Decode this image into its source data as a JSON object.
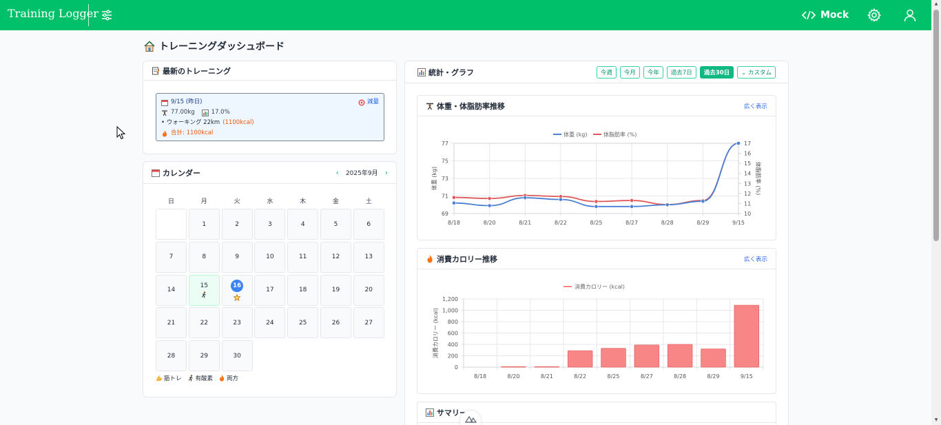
{
  "header": {
    "brand": "Training Logger",
    "mock_label": "Mock"
  },
  "page": {
    "title": "トレーニングダッシュボード"
  },
  "latest": {
    "title": "最新のトレーニング",
    "date": "9/15 (昨日)",
    "goal": "減量",
    "weight": "77.00kg",
    "body_fat": "17.0%",
    "activity": "• ウォーキング 22km",
    "activity_kcal": "(1100kcal)",
    "total": "合計: 1100kcal"
  },
  "calendar": {
    "title": "カレンダー",
    "month": "2025年9月",
    "weekdays": [
      "日",
      "月",
      "火",
      "水",
      "木",
      "金",
      "土"
    ],
    "legend": {
      "strength": "筋トレ",
      "cardio": "有酸素",
      "both": "両方"
    }
  },
  "stats": {
    "title": "統計・グラフ",
    "ranges": [
      "今週",
      "今月",
      "今年",
      "過去7日",
      "過去30日",
      "カスタム"
    ],
    "active_range": "過去30日",
    "expand": "広く表示",
    "summary_title": "サマリー"
  },
  "chart_data": [
    {
      "type": "line",
      "title": "体重・体脂肪率推移",
      "x": [
        "8/18",
        "8/20",
        "8/21",
        "8/22",
        "8/25",
        "8/27",
        "8/28",
        "8/29",
        "9/15"
      ],
      "series": [
        {
          "name": "体重 (kg)",
          "axis": "left",
          "color": "#4a7fd6",
          "values": [
            70.2,
            69.9,
            70.8,
            70.6,
            69.8,
            69.8,
            70.0,
            70.4,
            77.0
          ]
        },
        {
          "name": "体脂肪率 (%)",
          "axis": "right",
          "color": "#e05757",
          "values": [
            11.6,
            11.5,
            11.8,
            11.7,
            11.2,
            11.3,
            10.9,
            11.3,
            17.0
          ]
        }
      ],
      "ylabel": "体重 (kg)",
      "ylabel_right": "体脂肪率 (%)",
      "ylim": [
        69,
        77
      ],
      "yticks": [
        69,
        71,
        73,
        75,
        77
      ],
      "ylim_right": [
        10,
        17
      ],
      "yticks_right": [
        10,
        11,
        12,
        13,
        14,
        15,
        16,
        17
      ],
      "grid": true,
      "legend": "top"
    },
    {
      "type": "bar",
      "title": "消費カロリー推移",
      "categories": [
        "8/18",
        "8/20",
        "8/21",
        "8/22",
        "8/25",
        "8/27",
        "8/28",
        "8/29",
        "9/15"
      ],
      "series": [
        {
          "name": "消費カロリー (kcal)",
          "color": "#f88686",
          "values": [
            0,
            10,
            10,
            290,
            330,
            390,
            400,
            320,
            1090
          ]
        }
      ],
      "ylabel": "消費カロリー (kcal)",
      "ylim": [
        0,
        1200
      ],
      "yticks": [
        "0",
        "200",
        "400",
        "600",
        "800",
        "1,000",
        "1,200"
      ],
      "grid": true,
      "legend": "top"
    }
  ]
}
